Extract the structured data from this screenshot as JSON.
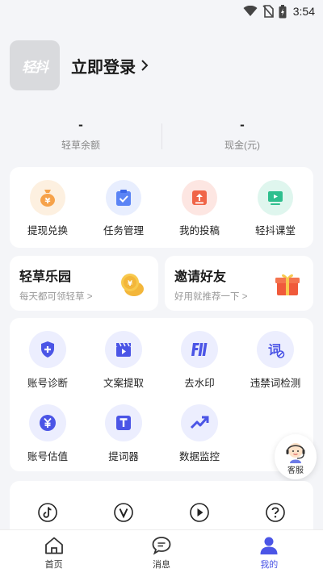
{
  "status_bar": {
    "time": "3:54"
  },
  "profile": {
    "avatar_text": "轻抖",
    "login_label": "立即登录"
  },
  "stats": [
    {
      "value": "-",
      "label": "轻草余额"
    },
    {
      "value": "-",
      "label": "现金(元)"
    }
  ],
  "quick_actions": [
    {
      "label": "提现兑换",
      "icon": "yen-bag-icon",
      "color": "#f6a24a"
    },
    {
      "label": "任务管理",
      "icon": "clipboard-check-icon",
      "color": "#5b84f5"
    },
    {
      "label": "我的投稿",
      "icon": "upload-tray-icon",
      "color": "#f06548"
    },
    {
      "label": "轻抖课堂",
      "icon": "presentation-icon",
      "color": "#2fbf8e"
    }
  ],
  "promos": [
    {
      "title": "轻草乐园",
      "subtitle": "每天都可领轻草 >",
      "icon": "coin-stack-icon"
    },
    {
      "title": "邀请好友",
      "subtitle": "好用就推荐一下 >",
      "icon": "gift-box-icon"
    }
  ],
  "tools": [
    {
      "label": "账号诊断",
      "icon": "shield-plus-icon"
    },
    {
      "label": "文案提取",
      "icon": "clapper-icon"
    },
    {
      "label": "去水印",
      "icon": "watermark-icon"
    },
    {
      "label": "违禁词检测",
      "icon": "word-check-icon"
    },
    {
      "label": "账号估值",
      "icon": "yen-circle-icon"
    },
    {
      "label": "提词器",
      "icon": "teleprompter-icon"
    },
    {
      "label": "数据监控",
      "icon": "trend-up-icon"
    }
  ],
  "platforms": [
    {
      "icon": "tiktok-icon"
    },
    {
      "icon": "vlog-icon"
    },
    {
      "icon": "play-circle-icon"
    },
    {
      "icon": "help-circle-icon"
    }
  ],
  "customer_service": {
    "label": "客服"
  },
  "bottom_nav": [
    {
      "label": "首页",
      "icon": "home-icon",
      "active": false
    },
    {
      "label": "消息",
      "icon": "message-icon",
      "active": false
    },
    {
      "label": "我的",
      "icon": "user-icon",
      "active": true
    }
  ],
  "colors": {
    "accent": "#4b55e6",
    "tool_icon": "#4b55e6",
    "tool_bg": "#eceefe"
  }
}
